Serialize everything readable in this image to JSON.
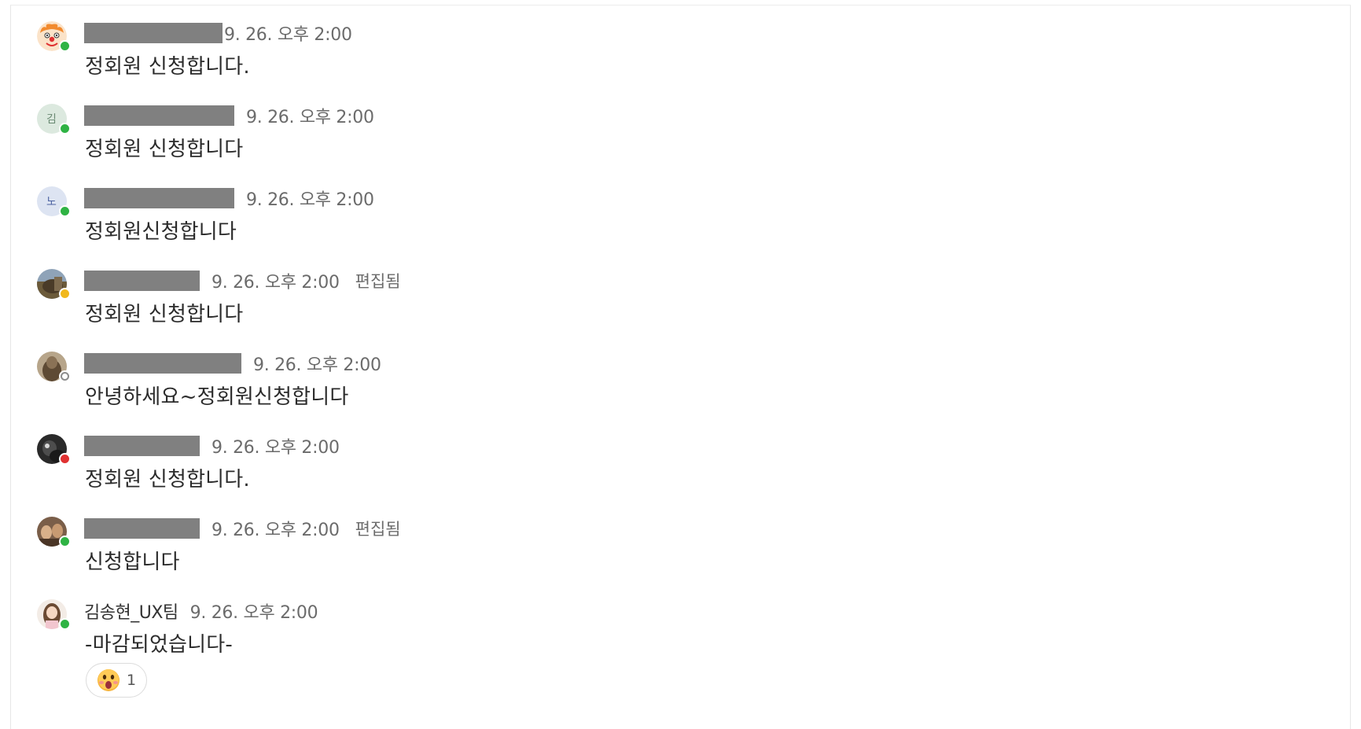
{
  "messages": [
    {
      "sender": "",
      "time": "9. 26. 오후 2:00",
      "edited": "",
      "text": "정회원 신청합니다.",
      "status": "online",
      "avatar": "clown-face-icon"
    },
    {
      "sender": "",
      "time": "9. 26. 오후 2:00",
      "edited": "",
      "text": "정회원 신청합니다",
      "status": "online",
      "avatar_initial": "김"
    },
    {
      "sender": "",
      "time": "9. 26. 오후 2:00",
      "edited": "",
      "text": "정회원신청합니다",
      "status": "online",
      "avatar_initial": "노"
    },
    {
      "sender": "",
      "time": "9. 26. 오후 2:00",
      "edited": "편집됨",
      "text": "정회원 신청합니다",
      "status": "away",
      "avatar": "photo-avatar"
    },
    {
      "sender": "",
      "time": "9. 26. 오후 2:00",
      "edited": "",
      "text": "안녕하세요~정회원신청합니다",
      "status": "offline",
      "avatar": "photo-avatar"
    },
    {
      "sender": "",
      "time": "9. 26. 오후 2:00",
      "edited": "",
      "text": "정회원 신청합니다.",
      "status": "busy",
      "avatar": "photo-avatar"
    },
    {
      "sender": "",
      "time": "9. 26. 오후 2:00",
      "edited": "편집됨",
      "text": "신청합니다",
      "status": "online",
      "avatar": "photo-avatar"
    },
    {
      "sender": "김송현_UX팀",
      "time": "9. 26. 오후 2:00",
      "edited": "",
      "text": "-마감되었습니다-",
      "status": "online",
      "avatar": "photo-avatar"
    }
  ],
  "reaction": {
    "emoji": "shocked-face-emoji",
    "count": "1"
  },
  "colors": {
    "online": "#2fb344",
    "away": "#f1b81c",
    "busy": "#e03131",
    "redaction": "#808080"
  }
}
